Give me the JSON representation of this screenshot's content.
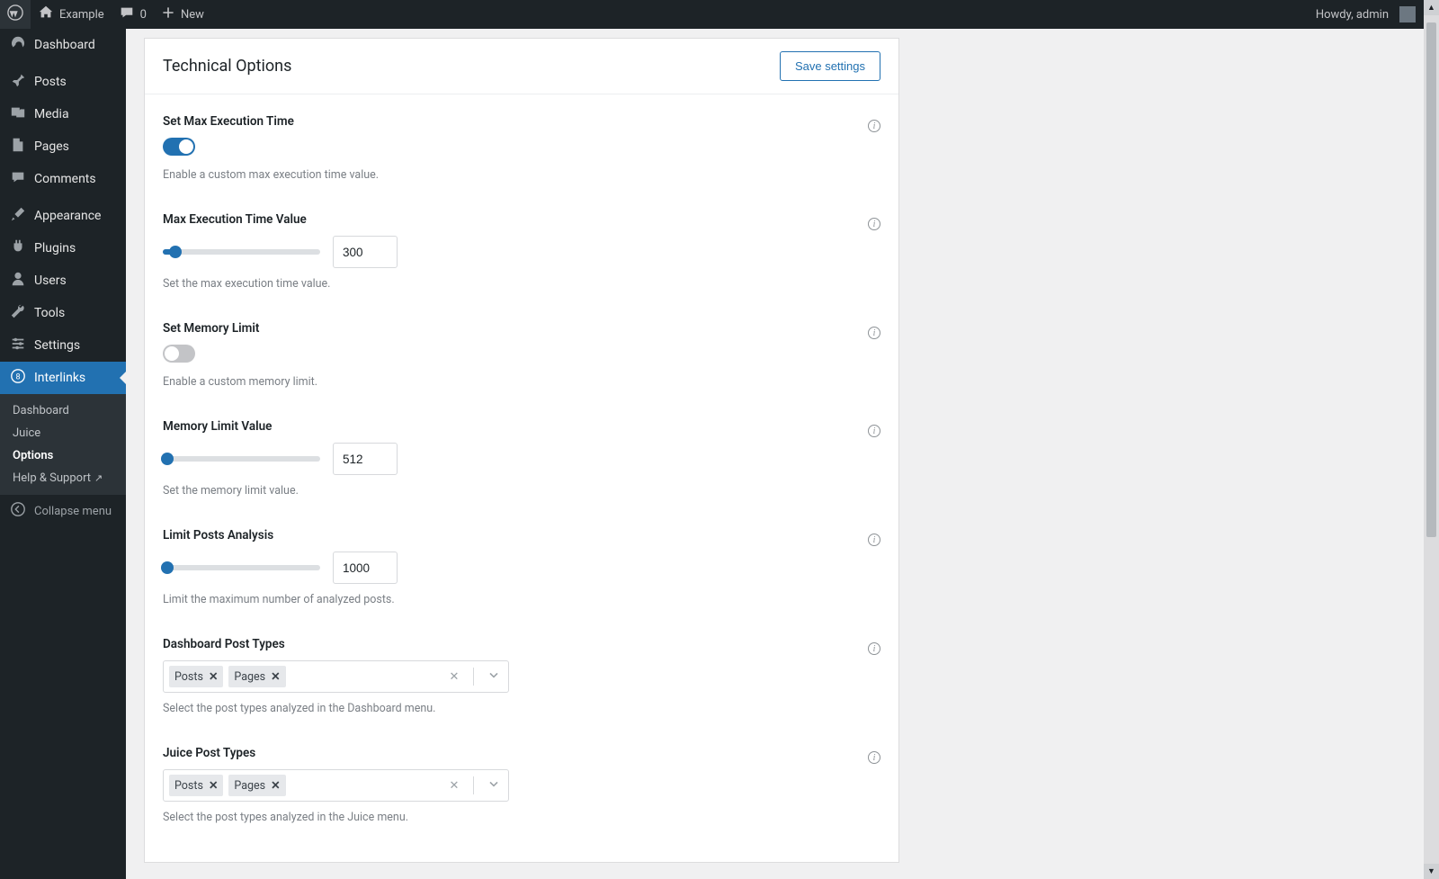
{
  "adminbar": {
    "site_name": "Example",
    "comment_count": "0",
    "new_label": "New",
    "howdy": "Howdy, admin"
  },
  "sidebar": {
    "items": [
      {
        "id": "dashboard",
        "label": "Dashboard"
      },
      {
        "id": "posts",
        "label": "Posts"
      },
      {
        "id": "media",
        "label": "Media"
      },
      {
        "id": "pages",
        "label": "Pages"
      },
      {
        "id": "comments",
        "label": "Comments"
      },
      {
        "id": "appearance",
        "label": "Appearance"
      },
      {
        "id": "plugins",
        "label": "Plugins"
      },
      {
        "id": "users",
        "label": "Users"
      },
      {
        "id": "tools",
        "label": "Tools"
      },
      {
        "id": "settings",
        "label": "Settings"
      },
      {
        "id": "interlinks",
        "label": "Interlinks"
      }
    ],
    "sub": [
      {
        "label": "Dashboard"
      },
      {
        "label": "Juice"
      },
      {
        "label": "Options"
      },
      {
        "label": "Help & Support"
      }
    ],
    "collapse": "Collapse menu"
  },
  "card": {
    "title": "Technical Options",
    "save": "Save settings"
  },
  "fields": {
    "set_max_exec": {
      "title": "Set Max Execution Time",
      "desc": "Enable a custom max execution time value.",
      "on": true
    },
    "max_exec_value": {
      "title": "Max Execution Time Value",
      "desc": "Set the max execution time value.",
      "value": "300",
      "percent": 8
    },
    "set_mem_limit": {
      "title": "Set Memory Limit",
      "desc": "Enable a custom memory limit.",
      "on": false
    },
    "mem_limit_value": {
      "title": "Memory Limit Value",
      "desc": "Set the memory limit value.",
      "value": "512",
      "percent": 0
    },
    "limit_posts": {
      "title": "Limit Posts Analysis",
      "desc": "Limit the maximum number of analyzed posts.",
      "value": "1000",
      "percent": 0
    },
    "dashboard_pt": {
      "title": "Dashboard Post Types",
      "desc": "Select the post types analyzed in the Dashboard menu.",
      "tags": [
        "Posts",
        "Pages"
      ]
    },
    "juice_pt": {
      "title": "Juice Post Types",
      "desc": "Select the post types analyzed in the Juice menu.",
      "tags": [
        "Posts",
        "Pages"
      ]
    }
  }
}
